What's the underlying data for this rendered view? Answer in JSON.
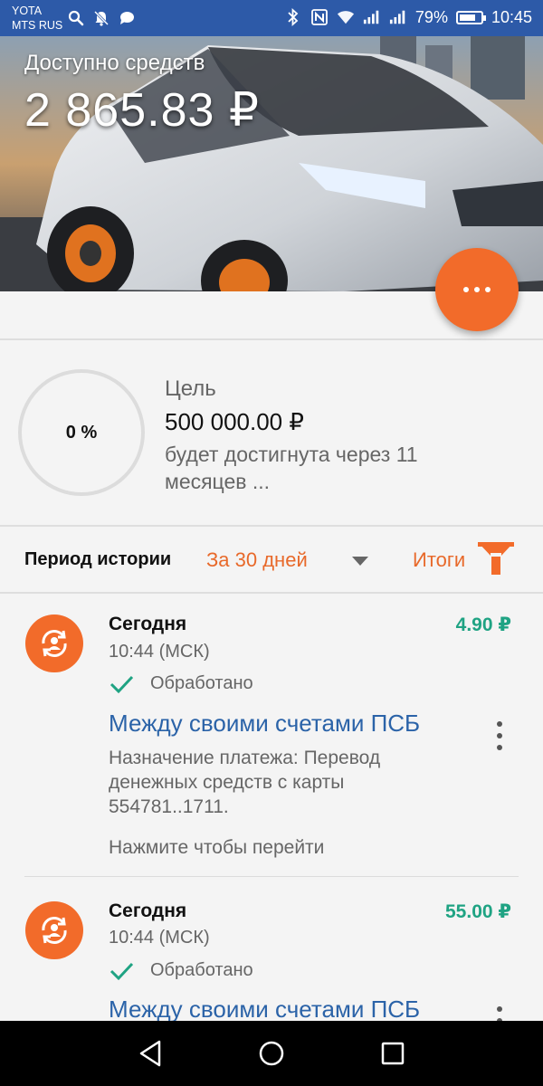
{
  "status_bar": {
    "carrier_1": "YOTA",
    "carrier_2": "MTS RUS",
    "battery_percent": "79%",
    "battery_level": 0.79,
    "time": "10:45",
    "left_icons": [
      "search-icon",
      "mute-bell-icon",
      "chat-icon"
    ],
    "right_icons": [
      "bluetooth-icon",
      "nfc-icon",
      "wifi-icon",
      "signal-icon",
      "signal-icon"
    ]
  },
  "balance": {
    "label": "Доступно средств",
    "amount": "2 865.83 ₽"
  },
  "goal": {
    "progress_text": "0 %",
    "progress": 0,
    "title": "Цель",
    "amount": "500 000.00 ₽",
    "description": "будет достигнута через 11 месяцев ..."
  },
  "history": {
    "period_label": "Период истории",
    "period_value": "За 30 дней",
    "totals_label": "Итоги"
  },
  "transactions": [
    {
      "date": "Сегодня",
      "time": "10:44 (МСК)",
      "status": "Обработано",
      "amount": "4.90 ₽",
      "title": "Между своими счетами ПСБ",
      "description": "Назначение платежа: Перевод денежных средств с карты 554781..1711.",
      "hint": "Нажмите чтобы перейти"
    },
    {
      "date": "Сегодня",
      "time": "10:44 (МСК)",
      "status": "Обработано",
      "amount": "55.00 ₽",
      "title": "Между своими счетами ПСБ"
    }
  ],
  "colors": {
    "accent": "#f26b2a",
    "status_bar": "#2d5aa8",
    "link": "#2b63a8",
    "amount_positive": "#1fa383"
  }
}
